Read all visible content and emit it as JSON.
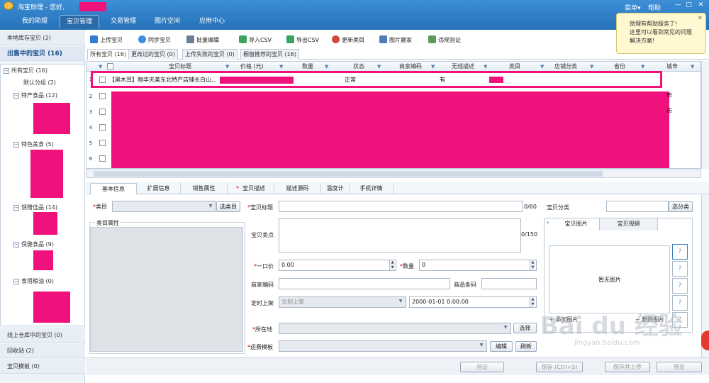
{
  "app": {
    "title": "淘宝助理 - 您好,",
    "menu": "菜单▾",
    "help": "帮助",
    "win_min": "—",
    "win_max": "□",
    "win_close": "✕"
  },
  "nav_tabs": [
    "我的助理",
    "宝贝管理",
    "交易管理",
    "图片空间",
    "应用中心"
  ],
  "tip": {
    "lines": [
      "助理有帮助服务了!",
      "这里可以看到常见的问题",
      "解决方案!"
    ],
    "close": "✕"
  },
  "sidebar": {
    "local": "本地库存宝贝 (2)",
    "selling": "出售中的宝贝 (16)",
    "tree": {
      "all": "所有宝贝 (16)",
      "default": "默认分组 (2)",
      "special": "特产食品 (12)",
      "food": "特色美食 (5)",
      "gift": "馈赠佳品 (14)",
      "health": "保健食品 (9)",
      "oil": "食用粮油 (0)",
      "toggle": "−"
    },
    "warehouse": "线上仓库中的宝贝 (0)",
    "recycle": "回收站 (2)",
    "template": "宝贝模板 (0)"
  },
  "toolbar": {
    "upload": "上传宝贝",
    "sync": "同步宝贝",
    "batch": "批量编辑",
    "import": "导入CSV",
    "export": "导出CSV",
    "update_cat": "更新类目",
    "img_search": "图片搬家",
    "violation": "违规验证"
  },
  "grid_tabs": [
    "所有宝贝 (16)",
    "更改过的宝贝 (0)",
    "上传失败的宝贝 (0)",
    "橱窗推荐的宝贝 (16)"
  ],
  "grid": {
    "headers": [
      "宝贝标题",
      "价格 (元)",
      "数量",
      "状态",
      "商家编码",
      "无线描述",
      "类目",
      "店铺分类",
      "省份",
      "城市"
    ],
    "row1": {
      "num": "1",
      "title": "【黑木耳】物华天美东北特产店铺长白山…",
      "status": "正常",
      "wireless": "有"
    },
    "row_nums": [
      "2",
      "3",
      "4",
      "5",
      "6"
    ],
    "partial_city": "市"
  },
  "detail_tabs": [
    "基本信息",
    "扩展信息",
    "销售属性",
    "宝贝描述",
    "描述源码",
    "温度计",
    "手机详情"
  ],
  "form": {
    "category_label": "类目",
    "category_btn": "选类目",
    "cat_props": "类目属性",
    "title_label": "宝贝标题",
    "title_count": "0/60",
    "selling_point": "宝贝卖点",
    "selling_count": "0/150",
    "price_label": "一口价",
    "price_val": "0.00",
    "qty_label": "数量",
    "qty_val": "0",
    "sku_label": "商家编码",
    "barcode_label": "商品条码",
    "schedule_label": "定时上架",
    "schedule_val": "立刻上架",
    "date_val": "2000-01-01  0:00:00",
    "location_label": "所在地",
    "location_btn": "选择",
    "shipping_label": "运费模板",
    "edit_btn": "编辑",
    "refresh_btn": "刷新",
    "shop_cat_label": "宝贝分类",
    "shop_cat_btn": "选分类",
    "pic_tab": "宝贝图片",
    "video_tab": "宝贝视频",
    "no_pic": "暂无图片",
    "add_pic": "+ 添加图片",
    "del_pic": "− 删除图片",
    "q": "?",
    "star": "*",
    "filter": "▼"
  },
  "bottom_btns": [
    "验证",
    "保存 (Ctrl+S)",
    "保存并上传",
    "预览"
  ],
  "watermark": {
    "text": "Bai du 经验",
    "url": "jingyan.baidu.com"
  }
}
